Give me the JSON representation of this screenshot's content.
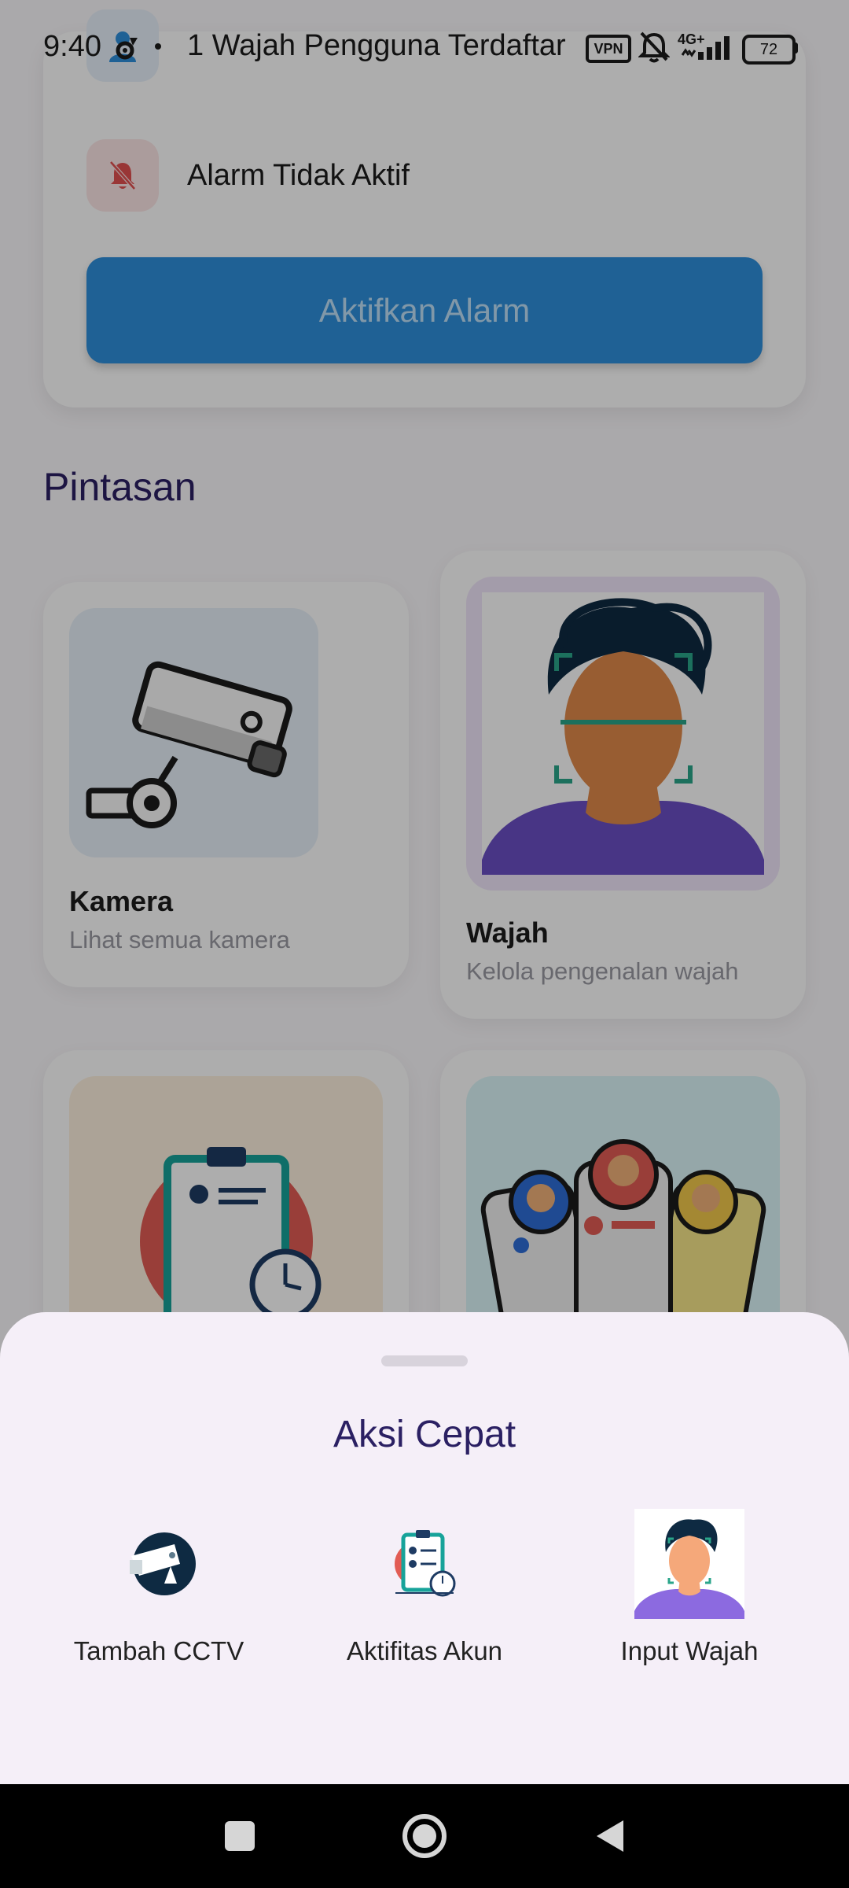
{
  "status_bar": {
    "time": "9:40",
    "vpn": "VPN",
    "network": "4G+",
    "battery": "72",
    "icons": [
      "settings-gear-icon",
      "dot-icon",
      "vpn-icon",
      "bell-off-icon",
      "signal-icon",
      "battery-icon"
    ]
  },
  "status_card": {
    "face_row": "1 Wajah Pengguna Terdaftar",
    "alarm_row": "Alarm Tidak Aktif",
    "activate_button": "Aktifkan Alarm"
  },
  "shortcuts": {
    "title": "Pintasan",
    "tiles": [
      {
        "title": "Kamera",
        "subtitle": "Lihat semua kamera",
        "icon": "cctv-camera-icon"
      },
      {
        "title": "Wajah",
        "subtitle": "Kelola pengenalan wajah",
        "icon": "face-scan-icon"
      },
      {
        "title": "",
        "subtitle": "",
        "icon": "clipboard-clock-icon"
      },
      {
        "title": "",
        "subtitle": "",
        "icon": "user-cards-icon"
      }
    ]
  },
  "quick_actions": {
    "title": "Aksi Cepat",
    "items": [
      {
        "label": "Tambah CCTV",
        "icon": "cctv-icon"
      },
      {
        "label": "Aktifitas Akun",
        "icon": "activity-clipboard-icon"
      },
      {
        "label": "Input Wajah",
        "icon": "face-input-icon"
      }
    ]
  },
  "nav": {
    "icons": [
      "recents-icon",
      "home-icon",
      "back-icon"
    ]
  },
  "colors": {
    "primary": "#2f8fdc",
    "title": "#2b2063",
    "sheet": "#f5eff8"
  }
}
